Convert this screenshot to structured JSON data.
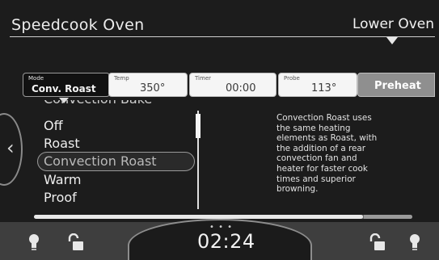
{
  "header": {
    "title": "Speedcook Oven",
    "oven_selector": "Lower Oven"
  },
  "tabs": {
    "mode": {
      "label": "Mode",
      "value": "Conv. Roast"
    },
    "temp": {
      "label": "Temp",
      "value": "350°"
    },
    "timer": {
      "label": "Timer",
      "value": "00:00"
    },
    "probe": {
      "label": "Probe",
      "value": "113°"
    },
    "preheat": {
      "label": "Preheat"
    }
  },
  "mode_list": {
    "items": [
      "Convection Bake",
      "Off",
      "Roast",
      "Convection Roast",
      "Warm",
      "Proof"
    ],
    "selected": "Convection Roast"
  },
  "description": "Convection Roast uses\nthe same heating\nelements as Roast, with\nthe addition of a rear\nconvection fan and\nheater for faster cook\ntimes and superior\nbrowning.",
  "footer": {
    "clock": "02:24",
    "page_dots": "• • •"
  },
  "progress_fraction": 0.87,
  "icons": {
    "left_light": "lightbulb-icon",
    "left_lock": "lock-open-icon",
    "right_lock": "lock-open-icon",
    "right_light": "lightbulb-icon"
  },
  "colors": {
    "background": "#1c1c1c",
    "tab_light": "#f5f5f5",
    "preheat": "#8f8f8f",
    "footer": "#3e3e3e"
  }
}
